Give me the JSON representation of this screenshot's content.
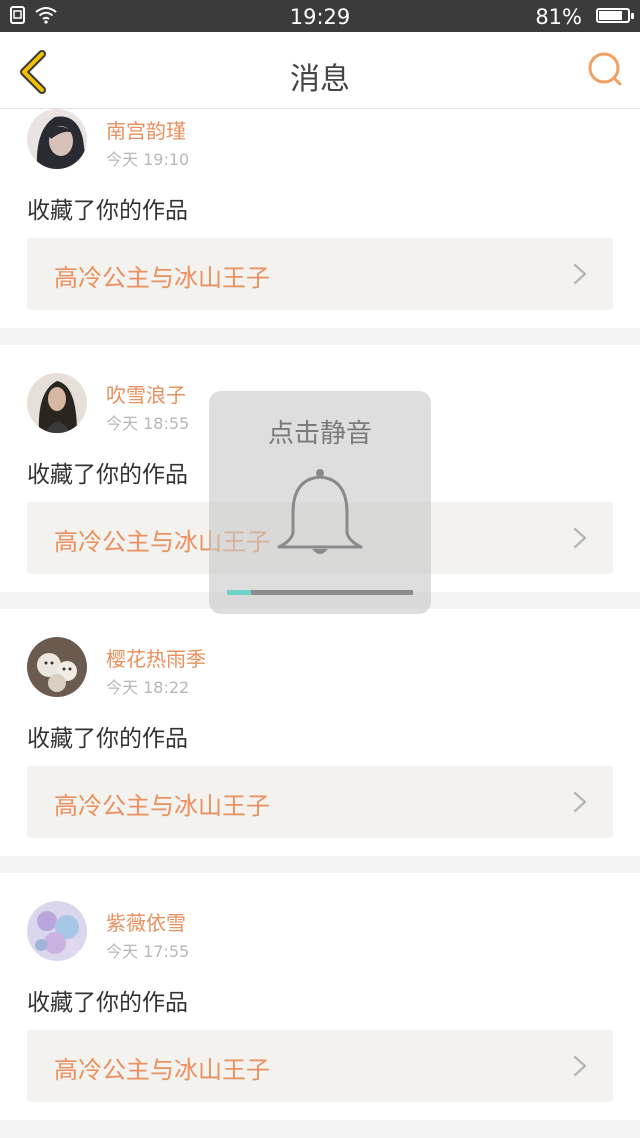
{
  "status_bar": {
    "time": "19:29",
    "battery": "81%",
    "battery_level": 0.81
  },
  "nav": {
    "title": "消息",
    "back_icon": "chevron-left-icon",
    "search_icon": "search-icon"
  },
  "messages": [
    {
      "name": "南宫韵瑾",
      "time": "今天 19:10",
      "action": "收藏了你的作品",
      "work_title": "高冷公主与冰山王子"
    },
    {
      "name": "吹雪浪子",
      "time": "今天 18:55",
      "action": "收藏了你的作品",
      "work_title": "高冷公主与冰山王子"
    },
    {
      "name": "樱花热雨季",
      "time": "今天 18:22",
      "action": "收藏了你的作品",
      "work_title": "高冷公主与冰山王子"
    },
    {
      "name": "紫薇依雪",
      "time": "今天 17:55",
      "action": "收藏了你的作品",
      "work_title": "高冷公主与冰山王子"
    }
  ],
  "toast": {
    "text": "点击静音",
    "volume_level": 0.13,
    "icon": "bell-icon"
  },
  "colors": {
    "accent": "#e8905e",
    "back_icon": "#f2c200",
    "progress": "#6fd2c8"
  }
}
